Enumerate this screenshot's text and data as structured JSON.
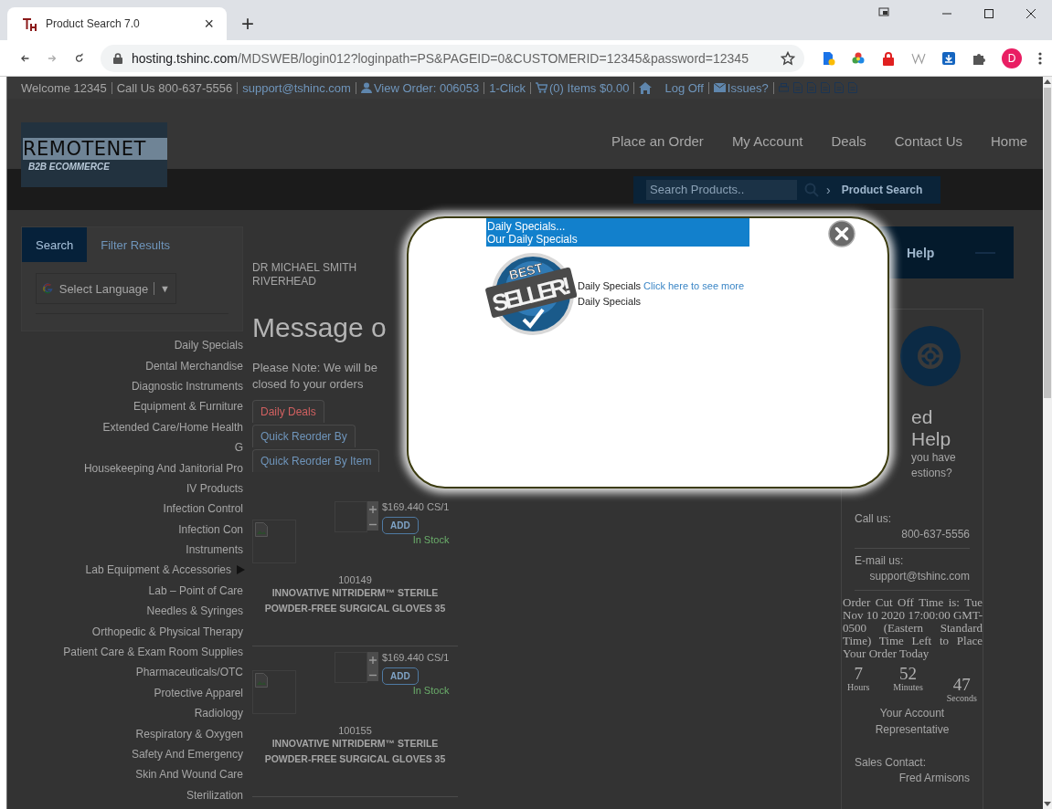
{
  "browser": {
    "tab_title": "Product Search 7.0",
    "tab_close": "×",
    "new_tab": "+",
    "url_host": "hosting.tshinc.com",
    "url_path": "/MDSWEB/login012?loginpath=PS&PAGEID=0&CUSTOMERID=12345&password=12345",
    "profile_initial": "D"
  },
  "top_bar": {
    "items": [
      {
        "kind": "text",
        "text": "Welcome 12345"
      },
      {
        "kind": "text",
        "text": "Call Us 800-637-5556"
      },
      {
        "kind": "link",
        "text": "support@tshinc.com"
      },
      {
        "kind": "account",
        "text": "View Order: 006053"
      },
      {
        "kind": "link",
        "text": "1-Click"
      },
      {
        "kind": "cart",
        "text": "(0) Items $0.00"
      },
      {
        "kind": "home",
        "text": "Log Off"
      },
      {
        "kind": "mail",
        "text": "Issues?"
      }
    ]
  },
  "header": {
    "logo_title": "REMOTENET",
    "logo_subtitle": "B2B ECOMMERCE",
    "nav": [
      "Place an Order",
      "My Account",
      "Deals",
      "Contact Us",
      "Home"
    ],
    "search": {
      "placeholder": "Search Products..",
      "chevron": "›",
      "button": "Product Search"
    }
  },
  "left_panel": {
    "tabs": [
      {
        "label": "Search",
        "selected": true
      },
      {
        "label": "Filter Results",
        "selected": false
      }
    ],
    "language": {
      "label": "Select Language",
      "arrow": "▼"
    },
    "categories": [
      {
        "label": "Daily Specials",
        "expandable": false
      },
      {
        "label": "Dental Merchandise",
        "expandable": false
      },
      {
        "label": "Diagnostic Instruments",
        "expandable": false
      },
      {
        "label": "Equipment & Furniture",
        "expandable": false
      },
      {
        "label": "Extended Care/Home Health",
        "expandable": false
      },
      {
        "label": "G",
        "expandable": false
      },
      {
        "label": "Housekeeping And Janitorial Pro",
        "expandable": false
      },
      {
        "label": "IV Products",
        "expandable": false
      },
      {
        "label": "Infection Control",
        "expandable": false
      },
      {
        "label": "Infection Con",
        "expandable": false
      },
      {
        "label": "Instruments",
        "expandable": false
      },
      {
        "label": "Lab Equipment & Accessories",
        "expandable": true
      },
      {
        "label": "Lab – Point of Care",
        "expandable": false
      },
      {
        "label": "Needles & Syringes",
        "expandable": false
      },
      {
        "label": "Orthopedic & Physical Therapy",
        "expandable": false
      },
      {
        "label": "Patient Care & Exam Room Supplies",
        "expandable": false
      },
      {
        "label": "Pharmaceuticals/OTC",
        "expandable": false
      },
      {
        "label": "Protective Apparel",
        "expandable": false
      },
      {
        "label": "Radiology",
        "expandable": false
      },
      {
        "label": "Respiratory & Oxygen",
        "expandable": false
      },
      {
        "label": "Safety And Emergency",
        "expandable": false
      },
      {
        "label": "Skin And Wound Care",
        "expandable": false
      },
      {
        "label": "Sterilization",
        "expandable": false
      }
    ]
  },
  "main": {
    "customer": "DR MICHAEL SMITH RIVERHEAD",
    "heading": "Message o",
    "note": "Please Note: We will be closed fo your orders",
    "tabs": [
      {
        "label": "Daily Deals",
        "selected": true
      },
      {
        "label": "Quick Reorder By",
        "selected": false
      },
      {
        "label": "Quick Reorder By Item",
        "selected": false
      }
    ],
    "products": [
      {
        "price": "$169.440 CS/1",
        "add": "ADD",
        "stock": "In Stock",
        "sku": "100149",
        "name": "INNOVATIVE NITRIDERM™ STERILE POWDER-FREE SURGICAL GLOVES 35"
      },
      {
        "price": "$169.440 CS/1",
        "add": "ADD",
        "stock": "In Stock",
        "sku": "100155",
        "name": "INNOVATIVE NITRIDERM™ STERILE POWDER-FREE SURGICAL GLOVES 35"
      }
    ]
  },
  "help_panel": {
    "title": "Help",
    "heading": "ed Help",
    "question_lines": [
      "you have",
      "estions?"
    ],
    "call_label": "Call us:",
    "phone": "800-637-5556",
    "email_label": "E-mail us:",
    "email": "support@tshinc.com",
    "cutoff": "Order Cut Off Time is: Tue Nov 10 2020 17:00:00 GMT-0500 (Eastern Standard Time) Time Left to Place Your Order Today",
    "countdown": [
      {
        "value": "7",
        "unit": "Hours"
      },
      {
        "value": "52",
        "unit": "Minutes"
      },
      {
        "value": "47",
        "unit": "Seconds"
      }
    ],
    "rep_title": "Your Account Representative",
    "sales_label": "Sales Contact:",
    "sales_name": "Fred Armisons"
  },
  "modal": {
    "header_lines": [
      "Daily Specials...",
      "Our Daily Specials"
    ],
    "badge_top": "BEST",
    "badge_main": "SELLER!",
    "line1": "Daily Specials",
    "link": "Click here to see more",
    "line2": "Daily Specials"
  }
}
